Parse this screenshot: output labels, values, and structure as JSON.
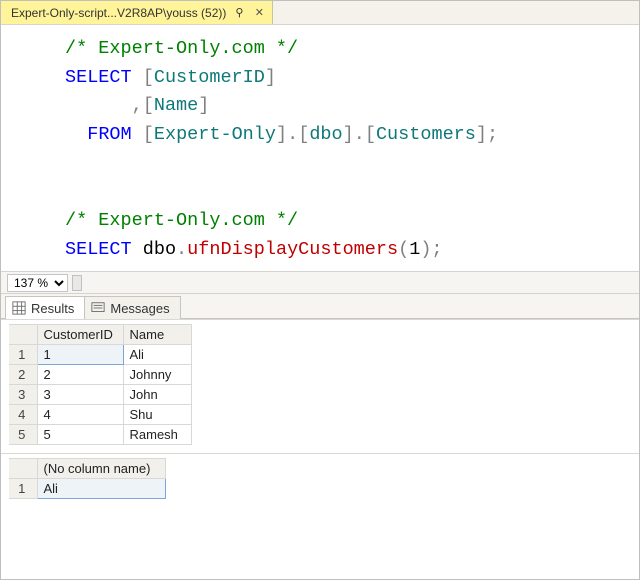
{
  "tab": {
    "label": "Expert-Only-script...V2R8AP\\youss (52))",
    "pin_icon": "⚲",
    "close_icon": "✕"
  },
  "sql": {
    "comment": "/* Expert-Only.com */",
    "select": "SELECT",
    "from": "FROM",
    "lbrack": "[",
    "rbrack": "]",
    "dot": ".",
    "comma": ",",
    "semi": ";",
    "customerid": "CustomerID",
    "name": "Name",
    "expertonly": "Expert-Only",
    "dbo": "dbo",
    "customers": "Customers",
    "func": "ufnDisplayCustomers",
    "lp": "(",
    "rp": ")",
    "one": "1"
  },
  "zoom": {
    "value": "137 %"
  },
  "resultTabs": {
    "results": "Results",
    "messages": "Messages"
  },
  "grid1": {
    "headers": {
      "c1": "CustomerID",
      "c2": "Name"
    },
    "rows": [
      {
        "n": "1",
        "id": "1",
        "name": "Ali"
      },
      {
        "n": "2",
        "id": "2",
        "name": "Johnny"
      },
      {
        "n": "3",
        "id": "3",
        "name": "John"
      },
      {
        "n": "4",
        "id": "4",
        "name": "Shu"
      },
      {
        "n": "5",
        "id": "5",
        "name": "Ramesh"
      }
    ]
  },
  "grid2": {
    "headers": {
      "c1": "(No column name)"
    },
    "rows": [
      {
        "n": "1",
        "v": "Ali"
      }
    ]
  }
}
